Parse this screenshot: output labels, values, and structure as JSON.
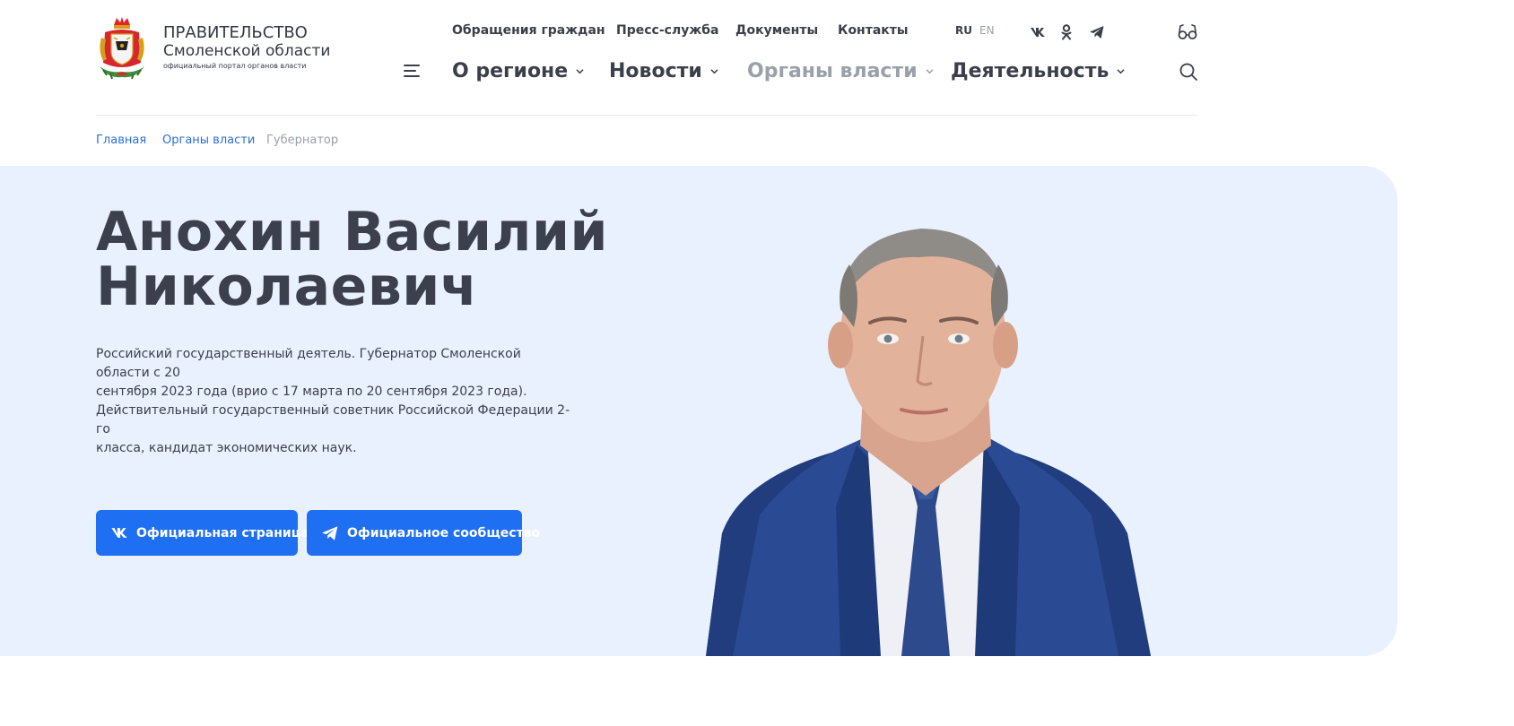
{
  "brand": {
    "line1": "ПРАВИТЕЛЬСТВО",
    "line2": "Смоленской области",
    "line3": "официальный портал органов власти"
  },
  "top_nav": [
    {
      "label": "Обращения граждан"
    },
    {
      "label": "Пресс-служба"
    },
    {
      "label": "Документы"
    },
    {
      "label": "Контакты"
    }
  ],
  "lang": {
    "ru": "RU",
    "en": "EN",
    "active": "RU"
  },
  "main_nav": [
    {
      "label": "О регионе",
      "muted": false
    },
    {
      "label": "Новости",
      "muted": false
    },
    {
      "label": "Органы власти",
      "muted": true
    },
    {
      "label": "Деятельность",
      "muted": false
    }
  ],
  "breadcrumb": [
    {
      "label": "Главная",
      "link": true
    },
    {
      "label": "Органы власти",
      "link": true
    },
    {
      "label": "Губернатор",
      "link": false
    }
  ],
  "hero": {
    "name_line1": "Анохин Василий",
    "name_line2": "Николаевич",
    "bio_line1": "Российский государственный деятель. Губернатор Смоленской области с 20",
    "bio_line2": "сентября 2023 года (врио с 17 марта по 20 сентября 2023 года).",
    "bio_line3": "Действительный государственный советник Российской Федерации  2-го",
    "bio_line4": "класса, кандидат экономических наук.",
    "button_vk": "Официальная страница",
    "button_tg": "Официальное сообщество"
  },
  "icons": {
    "vk": "vk-icon",
    "ok": "odnoklassniki-icon",
    "telegram": "telegram-icon",
    "accessibility": "glasses-icon",
    "search": "search-icon",
    "menu": "hamburger-icon"
  },
  "colors": {
    "accent": "#1e6ff2",
    "link": "#2a6fd6",
    "text": "#3b3f4a",
    "muted": "#9aa0aa",
    "hero_bg": "#e9f1ff"
  }
}
